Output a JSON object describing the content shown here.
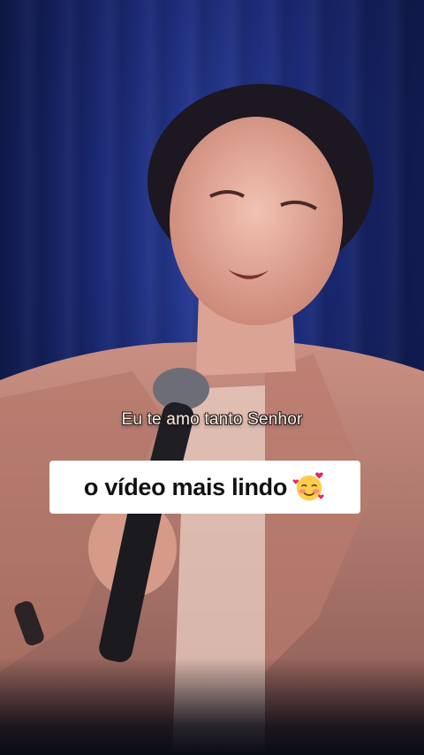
{
  "video": {
    "subtitle": "Eu te amo tanto Senhor",
    "caption": "o vídeo mais lindo",
    "caption_emoji": "smiling-face-with-hearts-icon"
  }
}
